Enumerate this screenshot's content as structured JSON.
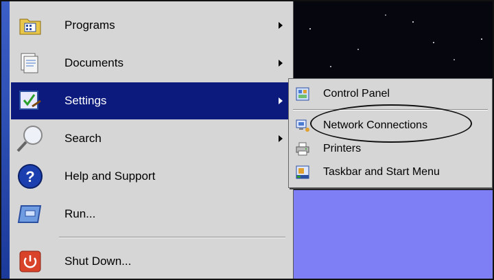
{
  "start_menu": {
    "items": [
      {
        "label": "Programs",
        "icon": "programs-folder-icon",
        "has_submenu": true
      },
      {
        "label": "Documents",
        "icon": "documents-icon",
        "has_submenu": true
      },
      {
        "label": "Settings",
        "icon": "settings-icon",
        "has_submenu": true,
        "selected": true
      },
      {
        "label": "Search",
        "icon": "magnifier-icon",
        "has_submenu": true
      },
      {
        "label": "Help and Support",
        "icon": "help-icon",
        "has_submenu": false
      },
      {
        "label": "Run...",
        "icon": "run-icon",
        "has_submenu": false
      },
      {
        "label": "Shut Down...",
        "icon": "power-icon",
        "has_submenu": false
      }
    ]
  },
  "settings_submenu": {
    "items": [
      {
        "label": "Control Panel",
        "icon": "control-panel-icon"
      },
      {
        "label": "Network Connections",
        "icon": "network-connections-icon",
        "highlighted_with_circle": true
      },
      {
        "label": "Printers",
        "icon": "printer-icon"
      },
      {
        "label": "Taskbar and Start Menu",
        "icon": "taskbar-icon"
      }
    ]
  },
  "colors": {
    "selected_bg": "#0b1a7c",
    "menu_bg": "#d6d6d6",
    "desktop": "#7f7ff5"
  }
}
